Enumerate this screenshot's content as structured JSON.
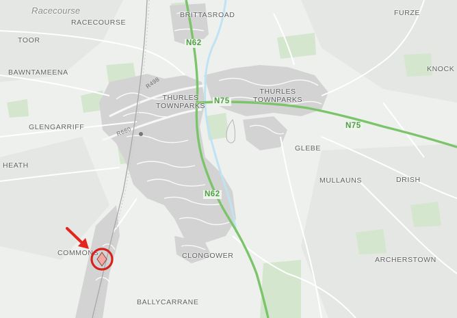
{
  "map": {
    "colors": {
      "background": "#eef0ee",
      "urban": "#d3d3d3",
      "park": "#d4e6cd",
      "national_road": "#7bc46a",
      "river": "#bfe3f2",
      "marker": "#d6221c",
      "arrow": "#e3251d"
    },
    "italic_labels": {
      "racecourse": "Racecourse"
    },
    "place_labels": {
      "brittasroad": "BRITTASROAD",
      "racecourse": "RACECOURSE",
      "furze": "FURZE",
      "toor": "TOOR",
      "knock": "KNOCK",
      "bawntameena": "BAWNTAMEENA",
      "glengarriff": "GLENGARRIFF",
      "glebe": "GLEBE",
      "heath": "HEATH",
      "mullauns": "MULLAUNS",
      "drish": "DRISH",
      "commons": "COMMONS",
      "clongower": "CLONGOWER",
      "archerstown": "ARCHERSTOWN",
      "ballycarrane": "BALLYCARRANE"
    },
    "towns": {
      "thurles_west": {
        "line1": "THURLES",
        "line2": "TOWNPARKS"
      },
      "thurles_east": {
        "line1": "THURLES",
        "line2": "TOWNPARKS"
      }
    },
    "road_shields": {
      "n62_north": "N62",
      "n75_center": "N75",
      "n75_east": "N75",
      "n62_south": "N62"
    },
    "road_labels": {
      "r498": "R498",
      "r660": "R660"
    },
    "marker": {
      "icon": "property-diamond-icon",
      "pointer": "red-arrow-icon"
    }
  }
}
